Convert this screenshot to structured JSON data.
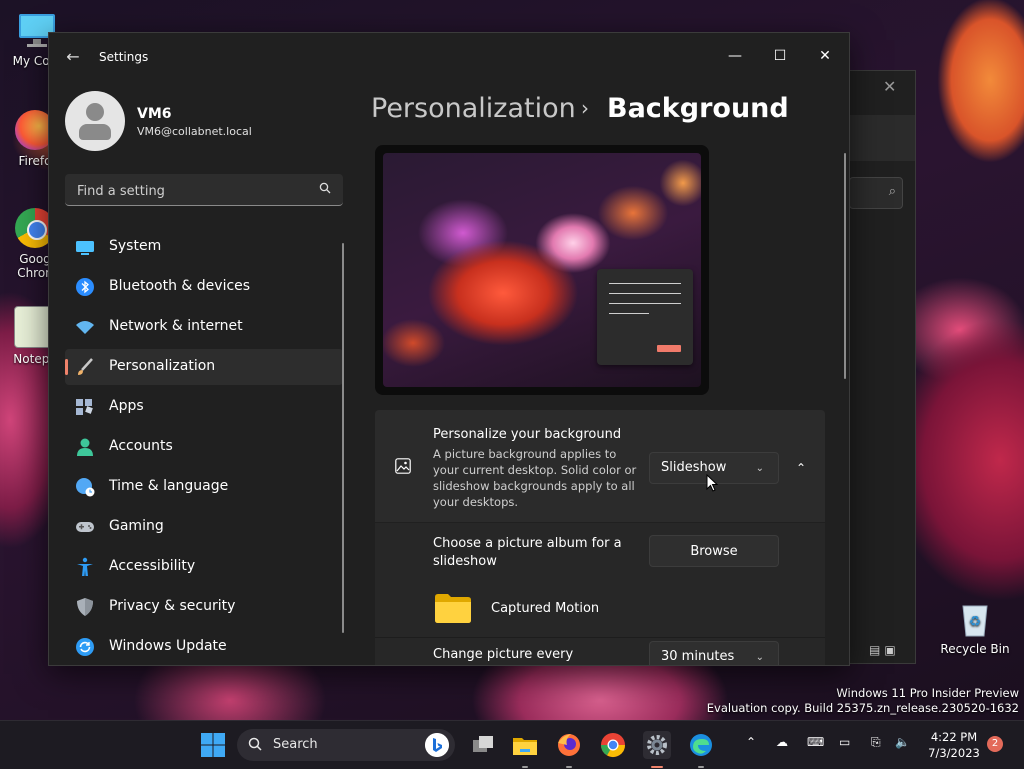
{
  "desktop": {
    "icons": [
      {
        "label": "My Com",
        "icon": "monitor-icon"
      },
      {
        "label": "Firefo",
        "icon": "firefox-icon"
      },
      {
        "label": "Goog Chron",
        "icon": "chrome-icon"
      },
      {
        "label": "Notepa",
        "icon": "notepad-icon"
      }
    ],
    "recycle_bin": "Recycle Bin",
    "watermark_line1": "Windows 11 Pro Insider Preview",
    "watermark_line2": "Evaluation copy. Build 25375.zn_release.230520-1632"
  },
  "window": {
    "title": "Settings",
    "controls": {
      "minimize": "—",
      "maximize": "☐",
      "close": "✕"
    }
  },
  "user": {
    "name": "VM6",
    "email": "VM6@collabnet.local"
  },
  "search": {
    "placeholder": "Find a setting"
  },
  "nav": [
    {
      "label": "System",
      "icon": "system-icon",
      "color": "#4cc2ff"
    },
    {
      "label": "Bluetooth & devices",
      "icon": "bluetooth-icon",
      "color": "#2b8dff"
    },
    {
      "label": "Network & internet",
      "icon": "wifi-icon",
      "color": "#62b6f0"
    },
    {
      "label": "Personalization",
      "icon": "brush-icon",
      "color": "#f0b26a",
      "selected": true
    },
    {
      "label": "Apps",
      "icon": "apps-icon",
      "color": "#a6b8d4"
    },
    {
      "label": "Accounts",
      "icon": "accounts-icon",
      "color": "#3ec79a"
    },
    {
      "label": "Time & language",
      "icon": "globe-clock-icon",
      "color": "#52a8f5"
    },
    {
      "label": "Gaming",
      "icon": "gamepad-icon",
      "color": "#bfc5cd"
    },
    {
      "label": "Accessibility",
      "icon": "accessibility-icon",
      "color": "#2e9cf5"
    },
    {
      "label": "Privacy & security",
      "icon": "shield-icon",
      "color": "#a9b0b8"
    },
    {
      "label": "Windows Update",
      "icon": "update-icon",
      "color": "#2e9cf5"
    }
  ],
  "breadcrumb": {
    "parent": "Personalization",
    "separator": "›",
    "current": "Background"
  },
  "background_setting": {
    "title": "Personalize your background",
    "description": "A picture background applies to your current desktop. Solid color or slideshow backgrounds apply to all your desktops.",
    "value": "Slideshow"
  },
  "album": {
    "label": "Choose a picture album for a slideshow",
    "button": "Browse",
    "folder_name": "Captured Motion"
  },
  "interval": {
    "label": "Change picture every",
    "value": "30 minutes"
  },
  "taskbar": {
    "search_label": "Search",
    "time": "4:22 PM",
    "date": "7/3/2023",
    "notification_count": "2"
  },
  "colors": {
    "accent": "#f0836b",
    "window_bg": "#202020",
    "card_bg": "#2b2b2b"
  }
}
